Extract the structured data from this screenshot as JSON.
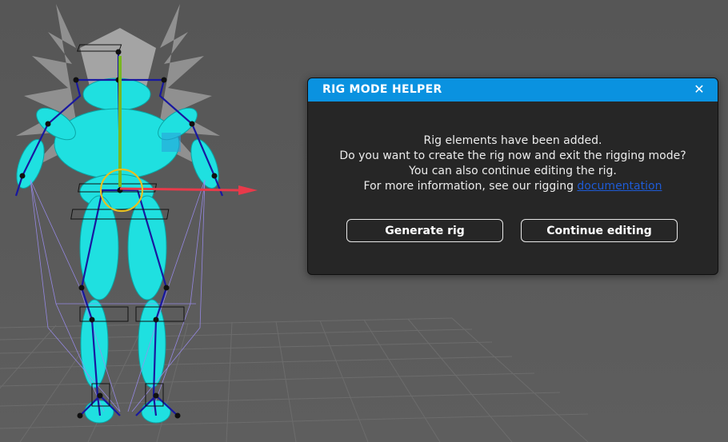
{
  "dialog": {
    "title": "RIG MODE HELPER",
    "close_glyph": "✕",
    "message_lines": [
      "Rig elements have been added.",
      "Do you want to create the rig now and exit the rigging mode?",
      "You can also continue editing the rig."
    ],
    "info_prefix": "For more information, see our rigging ",
    "info_link": "documentation",
    "generate_label": "Generate rig",
    "continue_label": "Continue editing"
  },
  "colors": {
    "header_accent": "#0a92e0",
    "body_model": "#1fe0e0",
    "bone": "#1818a0",
    "x_axis": "#e83a4a",
    "y_axis": "#7ab820",
    "selection_ring": "#e8c020"
  },
  "icons": {
    "close": "close-icon"
  }
}
